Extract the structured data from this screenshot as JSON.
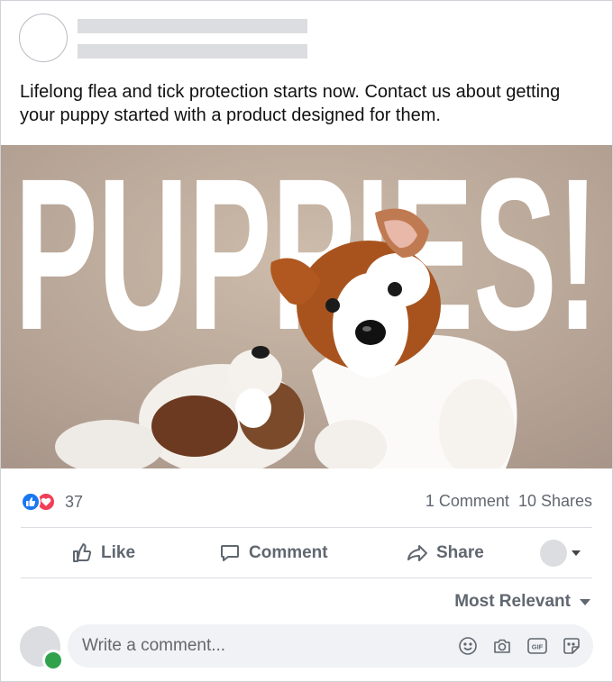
{
  "post": {
    "text": "Lifelong flea and tick protection starts now. Contact us about getting your puppy started with a product designed for them.",
    "image_headline": "PUPPIES!"
  },
  "reactions": {
    "types": [
      "like-icon",
      "love-icon"
    ],
    "count": "37"
  },
  "stats": {
    "comments": "1 Comment",
    "shares": "10 Shares"
  },
  "actions": {
    "like": "Like",
    "comment": "Comment",
    "share": "Share"
  },
  "sort": {
    "label": "Most Relevant"
  },
  "composer": {
    "placeholder": "Write a comment..."
  },
  "colors": {
    "like_blue": "#1877f2",
    "love_red": "#f33e58",
    "online_green": "#31a24c",
    "meta_gray": "#606770"
  }
}
